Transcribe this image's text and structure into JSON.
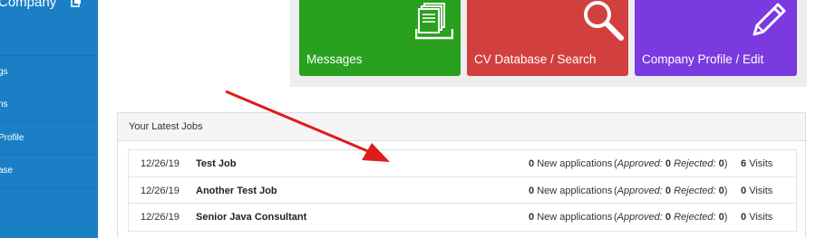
{
  "sidebar": {
    "title": "Company",
    "logout_icon": "logout-icon",
    "items": [
      {
        "label": "gs"
      },
      {
        "label": "ns"
      },
      {
        "label": "Profile"
      },
      {
        "label": "ase"
      }
    ]
  },
  "tiles": [
    {
      "label": "Messages",
      "icon": "documents-icon",
      "color": "#29a11f"
    },
    {
      "label": "CV Database / Search",
      "icon": "search-icon",
      "color": "#d23f3f"
    },
    {
      "label": "Company Profile / Edit",
      "icon": "pencil-icon",
      "color": "#7b3ae0"
    }
  ],
  "jobs": {
    "header": "Your Latest Jobs",
    "rows": [
      {
        "date": "12/26/19",
        "title": "Test Job",
        "new_count": "0",
        "new_label": "New applications",
        "approved_label": "Approved:",
        "approved": "0",
        "rejected_label": "Rejected:",
        "rejected": "0",
        "visits": "6",
        "visits_label": "Visits"
      },
      {
        "date": "12/26/19",
        "title": "Another Test Job",
        "new_count": "0",
        "new_label": "New applications",
        "approved_label": "Approved:",
        "approved": "0",
        "rejected_label": "Rejected:",
        "rejected": "0",
        "visits": "0",
        "visits_label": "Visits"
      },
      {
        "date": "12/26/19",
        "title": "Senior Java Consultant",
        "new_count": "0",
        "new_label": "New applications",
        "approved_label": "Approved:",
        "approved": "0",
        "rejected_label": "Rejected:",
        "rejected": "0",
        "visits": "0",
        "visits_label": "Visits"
      }
    ]
  },
  "annotation": {
    "arrow_color": "#e01b1b"
  }
}
